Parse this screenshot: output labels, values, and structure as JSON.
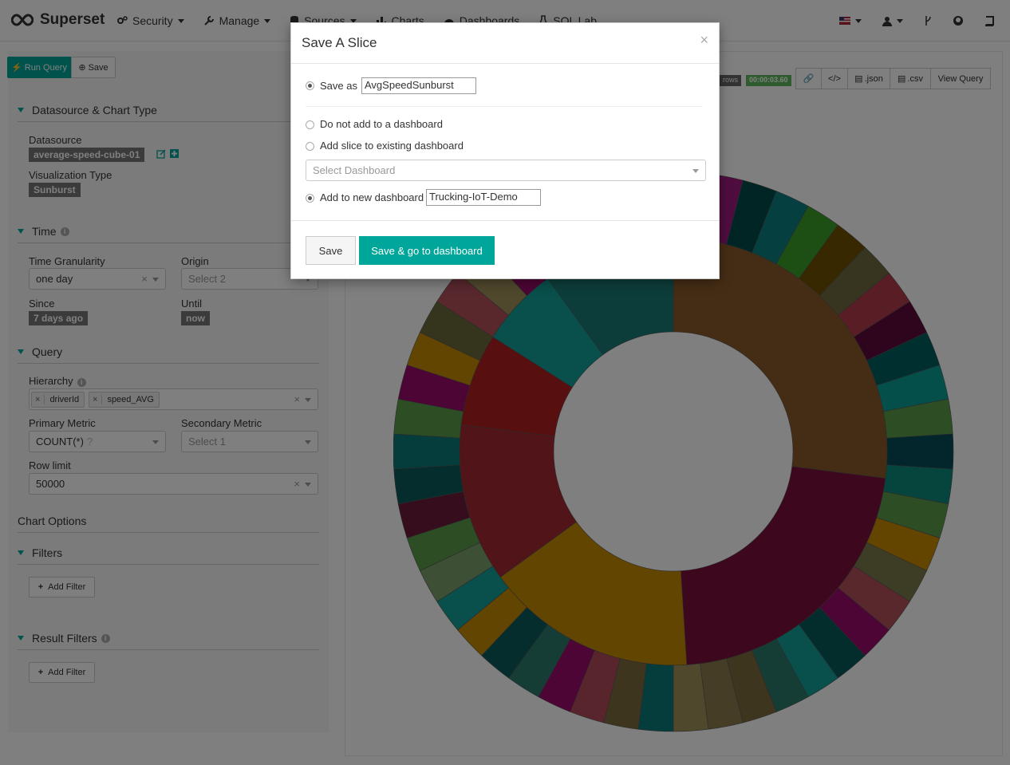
{
  "brand": {
    "name": "Superset"
  },
  "nav": {
    "items": [
      {
        "label": "Security",
        "icon": "gears-icon"
      },
      {
        "label": "Manage",
        "icon": "wrench-icon"
      },
      {
        "label": "Sources",
        "icon": "database-icon"
      },
      {
        "label": "Charts",
        "icon": "bar-chart-icon"
      },
      {
        "label": "Dashboards",
        "icon": "dashboard-icon"
      },
      {
        "label": "SQL Lab",
        "icon": "flask-icon"
      }
    ]
  },
  "query_buttons": {
    "run": "Run Query",
    "save": "Save"
  },
  "sections": {
    "datasource": "Datasource & Chart Type",
    "time": "Time",
    "query": "Query",
    "chart_options": "Chart Options",
    "filters": "Filters",
    "result_filters": "Result Filters"
  },
  "datasource": {
    "label": "Datasource",
    "value": "average-speed-cube-01",
    "viz_label": "Visualization Type",
    "viz_value": "Sunburst"
  },
  "time": {
    "granularity_label": "Time Granularity",
    "granularity_value": "one day",
    "origin_label": "Origin",
    "origin_placeholder": "Select 2",
    "since_label": "Since",
    "since_value": "7 days ago",
    "until_label": "Until",
    "until_value": "now"
  },
  "query": {
    "hierarchy_label": "Hierarchy",
    "hierarchy_values": [
      "driverId",
      "speed_AVG"
    ],
    "primary_label": "Primary Metric",
    "primary_value": "COUNT(*)",
    "secondary_label": "Secondary Metric",
    "secondary_placeholder": "Select 1",
    "rowlimit_label": "Row limit",
    "rowlimit_value": "50000"
  },
  "filters": {
    "add_filter": "Add Filter"
  },
  "result_filters": {
    "add_filter": "Add Filter"
  },
  "chart_header": {
    "rows_badge": "rows",
    "timer": "00:00:03.60",
    "json": ".json",
    "csv": ".csv",
    "view_query": "View Query"
  },
  "modal": {
    "title": "Save A Slice",
    "close": "×",
    "save_as_label": "Save as",
    "save_as_value": "AvgSpeedSunburst",
    "no_dashboard": "Do not add to a dashboard",
    "existing_dashboard": "Add slice to existing dashboard",
    "select_dashboard_placeholder": "Select Dashboard",
    "new_dashboard": "Add to new dashboard",
    "new_dashboard_value": "Trucking-IoT-Demo",
    "save_button": "Save",
    "save_go_button": "Save & go to dashboard"
  },
  "colors": {
    "accent": "#00a699",
    "inner": [
      "#8B5A2B",
      "#7a0f3a",
      "#c48a00",
      "#a32a33",
      "#b01f1f",
      "#139e96",
      "#1a7a75"
    ],
    "outer": [
      "#1f7f2a",
      "#9e1a7e",
      "#024b4b",
      "#0a7f7f",
      "#3a9f2a",
      "#6e5000",
      "#6e6a3e",
      "#b03a4a",
      "#5e0a3a",
      "#005f60",
      "#0a9f95",
      "#5a9a4a",
      "#064d5a",
      "#0a8a7a",
      "#5a9a4a",
      "#c88a00",
      "#7a7a4a",
      "#b0505a",
      "#9a0a6a",
      "#065a5a",
      "#139e96",
      "#2a7a6a",
      "#7a6a3a",
      "#8a7a4a",
      "#a0905a",
      "#0a7a7a",
      "#7a6a3a",
      "#b04a5a",
      "#9a0a6a",
      "#2a7a6a",
      "#0a5a5a",
      "#c48a00",
      "#139e96",
      "#7aa06a",
      "#5a9a4a",
      "#6a1a3a",
      "#0a5a5a",
      "#0a7a7a",
      "#5a9a4a",
      "#9a0a6a",
      "#c48a00",
      "#6a6a3a",
      "#b0505a",
      "#a0905a",
      "#9a0a6a",
      "#5a9a4a",
      "#0a4a4a",
      "#6a9a4a",
      "#0a7a6a",
      "#9a0a6a"
    ]
  }
}
